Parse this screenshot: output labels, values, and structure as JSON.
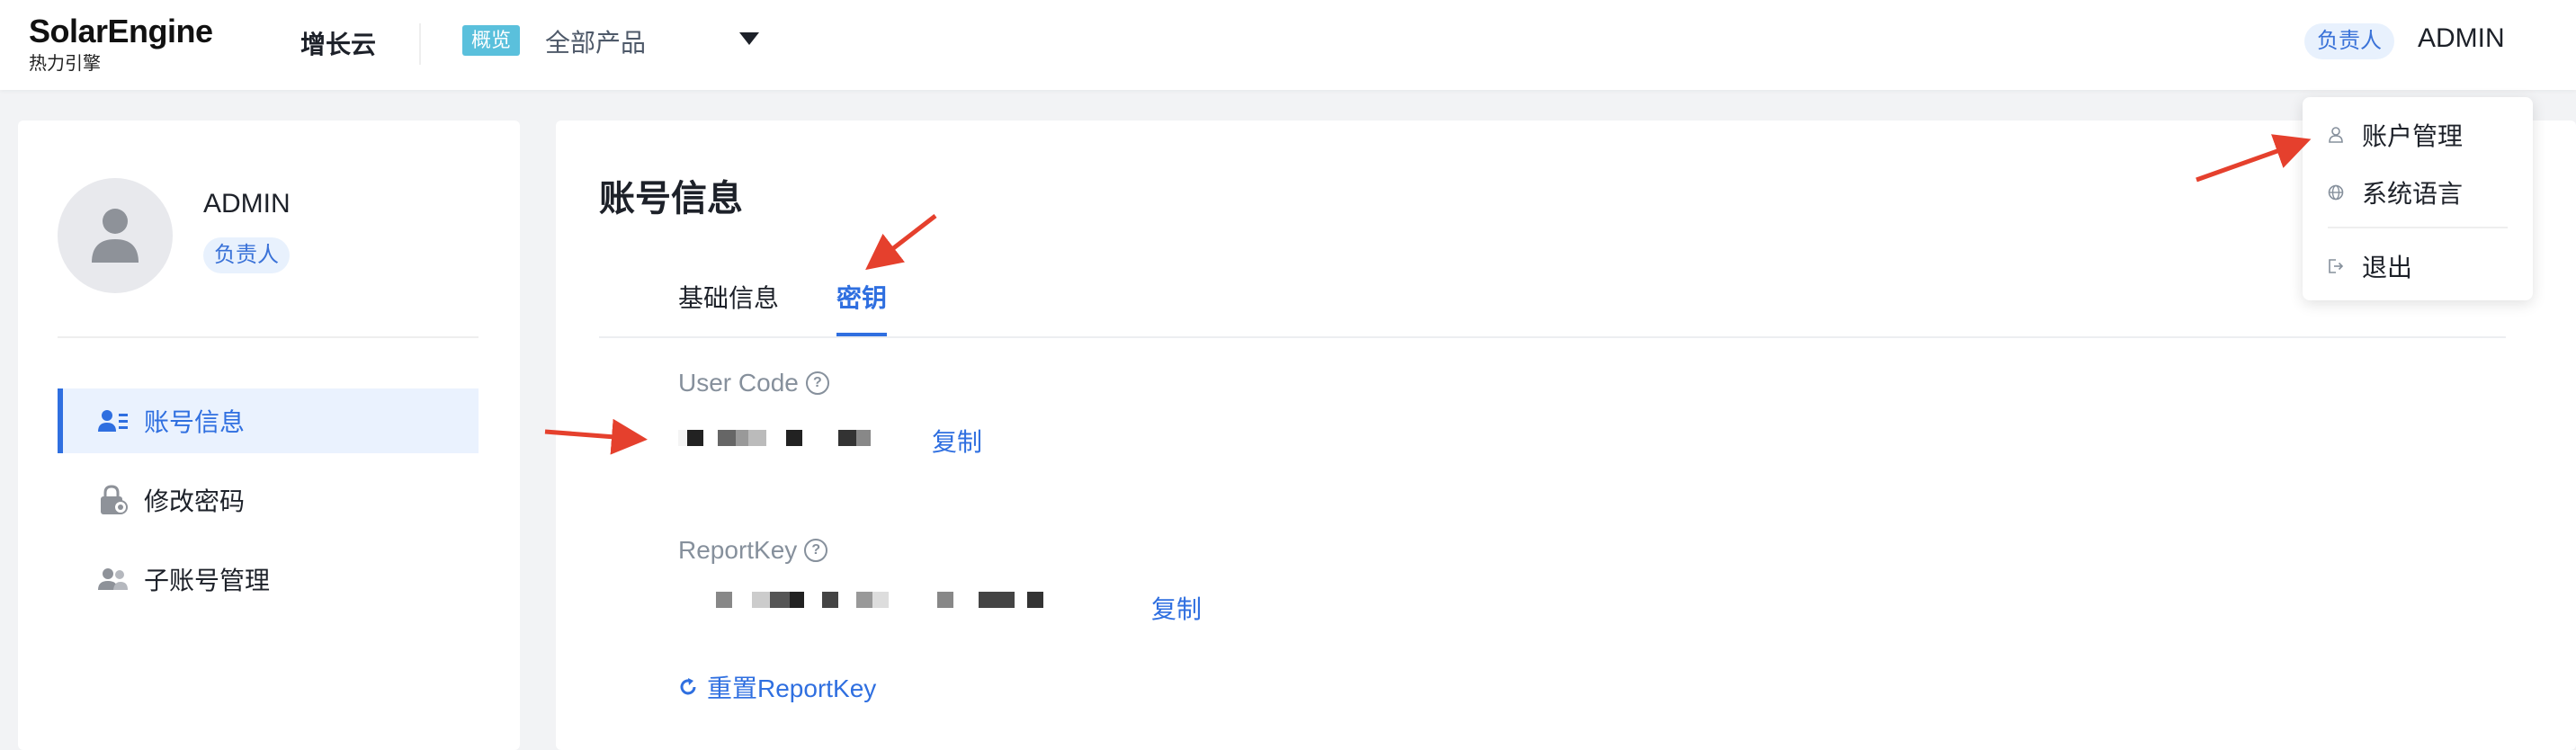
{
  "brand": {
    "name": "SolarEngine",
    "subtitle": "热力引擎"
  },
  "topnav": {
    "app_name": "增长云",
    "overview_tag": "概览",
    "product_select": "全部产品",
    "role_badge": "负责人",
    "user_name": "ADMIN"
  },
  "dropdown": {
    "items": [
      {
        "label": "账户管理",
        "icon": "user-icon"
      },
      {
        "label": "系统语言",
        "icon": "globe-icon"
      },
      {
        "label": "退出",
        "icon": "logout-icon"
      }
    ]
  },
  "profile": {
    "name": "ADMIN",
    "role": "负责人"
  },
  "sidebar": {
    "items": [
      {
        "label": "账号信息",
        "icon": "account-info-icon",
        "active": true
      },
      {
        "label": "修改密码",
        "icon": "lock-icon"
      },
      {
        "label": "子账号管理",
        "icon": "sub-account-icon"
      }
    ]
  },
  "main": {
    "title": "账号信息",
    "tabs": [
      {
        "label": "基础信息"
      },
      {
        "label": "密钥",
        "active": true
      }
    ],
    "user_code": {
      "label": "User Code",
      "copy_label": "复制"
    },
    "report_key": {
      "label": "ReportKey",
      "copy_label": "复制"
    },
    "reset_label": "重置ReportKey"
  },
  "colors": {
    "accent": "#2f6fe0",
    "annotation_arrow": "#e5402d",
    "overview_tag": "#5ac0dc"
  }
}
